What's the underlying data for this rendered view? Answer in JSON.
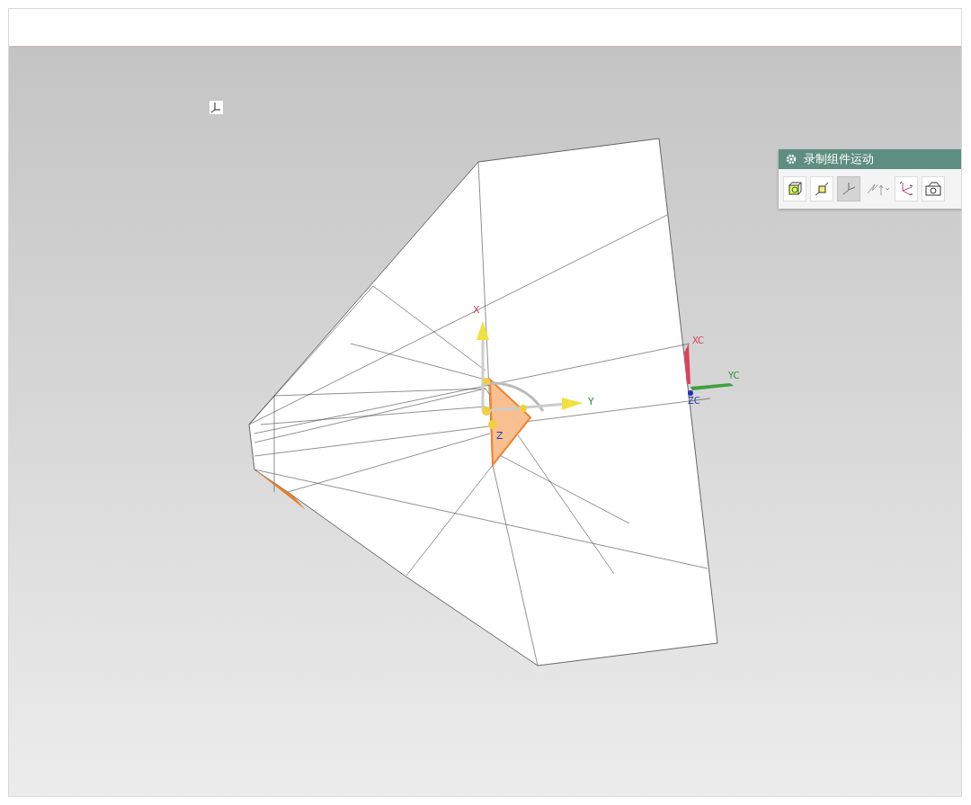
{
  "viewport": {
    "handle_axis_labels": [
      {
        "text": "X",
        "kind": "x"
      },
      {
        "text": "Y",
        "kind": "y"
      },
      {
        "text": "Z",
        "kind": "z"
      }
    ],
    "wcs_axis_labels": [
      {
        "text": "XC",
        "kind": "x"
      },
      {
        "text": "YC",
        "kind": "y"
      },
      {
        "text": "ZC",
        "kind": "z"
      }
    ]
  },
  "toolbar": {
    "title": "录制组件运动",
    "buttons": [
      {
        "kind": "cube",
        "selected": false
      },
      {
        "kind": "scale",
        "selected": false
      },
      {
        "kind": "csys",
        "selected": true
      },
      {
        "kind": "snap",
        "selected": false
      },
      {
        "kind": "wcs",
        "selected": false
      },
      {
        "kind": "camera",
        "selected": false
      }
    ]
  }
}
